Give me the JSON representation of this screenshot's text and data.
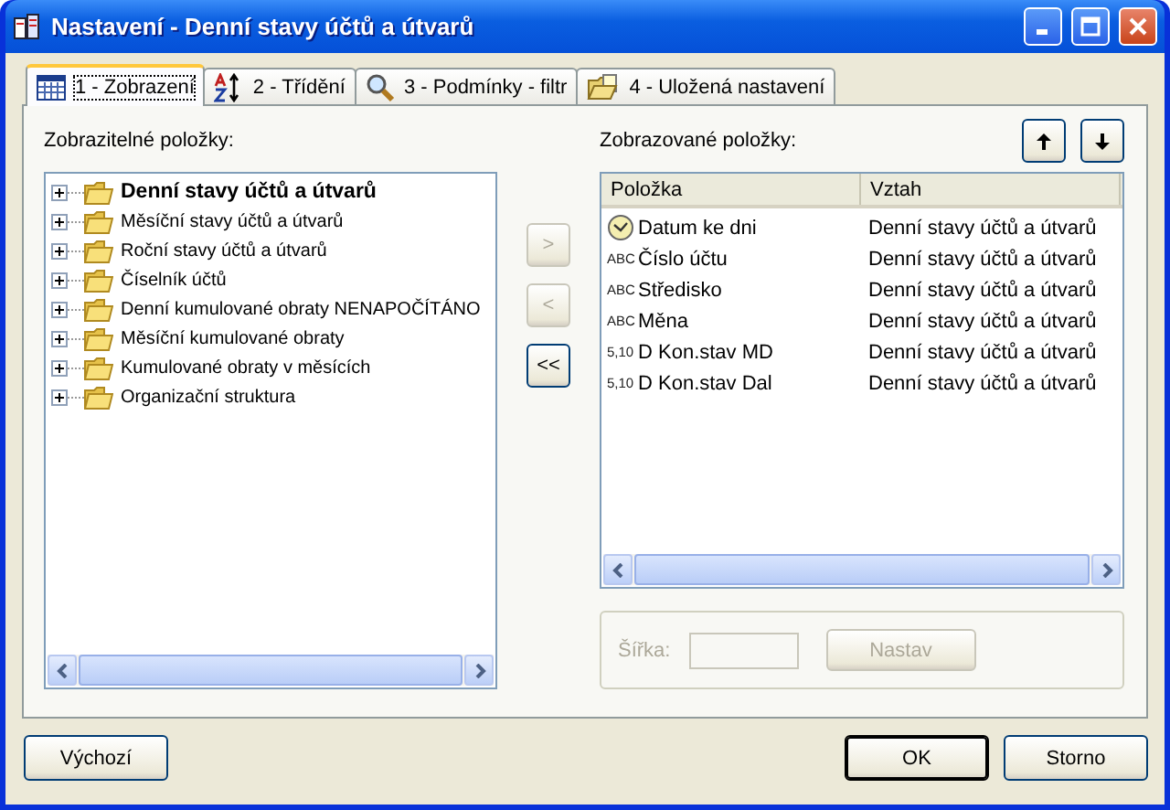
{
  "window": {
    "title": "Nastavení - Denní stavy účtů a útvarů"
  },
  "tabs": [
    {
      "kind": "display",
      "label": "1 - Zobrazení",
      "selected": true
    },
    {
      "kind": "sort",
      "label": "2 - Třídění",
      "selected": false
    },
    {
      "kind": "filter",
      "label": "3 - Podmínky - filtr",
      "selected": false
    },
    {
      "kind": "saved",
      "label": "4 - Uložená nastavení",
      "selected": false
    }
  ],
  "available": {
    "label": "Zobrazitelné položky:",
    "items": [
      {
        "label": "Denní stavy účtů a útvarů",
        "bold": true,
        "expanded": false
      },
      {
        "label": "Měsíční stavy účtů a útvarů",
        "bold": false,
        "expanded": false
      },
      {
        "label": "Roční stavy účtů a útvarů",
        "bold": false,
        "expanded": false
      },
      {
        "label": "Číselník účtů",
        "bold": false,
        "expanded": false
      },
      {
        "label": "Denní kumulované obraty NENAPOČÍTÁNO",
        "bold": false,
        "expanded": false
      },
      {
        "label": "Měsíční kumulované obraty",
        "bold": false,
        "expanded": false
      },
      {
        "label": "Kumulované obraty v měsících",
        "bold": false,
        "expanded": false
      },
      {
        "label": "Organizační struktura",
        "bold": false,
        "expanded": false
      }
    ]
  },
  "move_buttons": [
    {
      "label": ">",
      "disabled": true
    },
    {
      "label": "<",
      "disabled": true
    },
    {
      "label": "<<",
      "disabled": false
    }
  ],
  "displayed": {
    "label": "Zobrazované položky:",
    "columns": [
      "Položka",
      "Vztah"
    ],
    "rows": [
      {
        "kind": "date",
        "name": "Datum ke dni",
        "relation": "Denní stavy účtů a útvarů"
      },
      {
        "kind": "text",
        "type_icon": "ABC",
        "name": "Číslo účtu",
        "relation": "Denní stavy účtů a útvarů"
      },
      {
        "kind": "text",
        "type_icon": "ABC",
        "name": "Středisko",
        "relation": "Denní stavy účtů a útvarů"
      },
      {
        "kind": "text",
        "type_icon": "ABC",
        "name": "Měna",
        "relation": "Denní stavy účtů a útvarů"
      },
      {
        "kind": "number",
        "type_icon": "5,10",
        "name": "D Kon.stav MD",
        "relation": "Denní stavy účtů a útvarů"
      },
      {
        "kind": "number",
        "type_icon": "5,10",
        "name": "D Kon.stav Dal",
        "relation": "Denní stavy účtů a útvarů"
      }
    ]
  },
  "width_group": {
    "label": "Šířka:",
    "button": "Nastav",
    "disabled": true
  },
  "buttons": [
    {
      "label": "Výchozí",
      "default": false
    },
    {
      "label": "OK",
      "default": true
    },
    {
      "label": "Storno",
      "default": false
    }
  ]
}
